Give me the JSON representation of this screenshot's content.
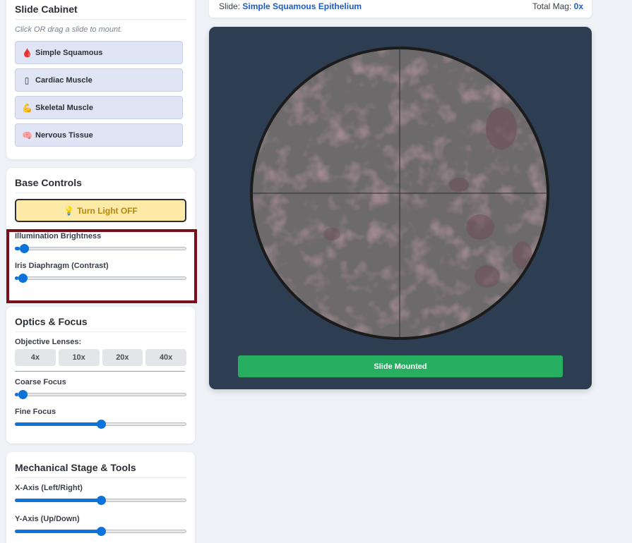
{
  "cabinet": {
    "title": "Slide Cabinet",
    "hint": "Click OR drag a slide to mount.",
    "slides": [
      {
        "icon": "🩸",
        "label": "Simple Squamous"
      },
      {
        "icon": "▯",
        "label": "Cardiac Muscle"
      },
      {
        "icon": "💪",
        "label": "Skeletal Muscle"
      },
      {
        "icon": "🧠",
        "label": "Nervous Tissue"
      }
    ]
  },
  "base": {
    "title": "Base Controls",
    "light_icon": "💡",
    "light_label": "Turn Light OFF",
    "brightness_label": "Illumination Brightness",
    "brightness_value": 0.03,
    "iris_label": "Iris Diaphragm (Contrast)",
    "iris_value": 0.02
  },
  "optics": {
    "title": "Optics & Focus",
    "lens_label": "Objective Lenses:",
    "lenses": [
      "4x",
      "10x",
      "20x",
      "40x"
    ],
    "coarse_label": "Coarse Focus",
    "coarse_value": 0.02,
    "fine_label": "Fine Focus",
    "fine_value": 0.5
  },
  "mech": {
    "title": "Mechanical Stage & Tools",
    "x_label": "X-Axis (Left/Right)",
    "x_value": 0.5,
    "y_label": "Y-Axis (Up/Down)",
    "y_value": 0.5
  },
  "status": {
    "slide_prefix": "Slide:",
    "slide_name": "Simple Squamous Epithelium",
    "mag_prefix": "Total Mag:",
    "mag_value": "0x"
  },
  "viewer": {
    "mount_label": "Slide Mounted"
  },
  "colors": {
    "accent": "#0b73d9",
    "mounted": "#27ae60",
    "highlight": "#7a0f1c",
    "scope_bg": "#2e3e52"
  }
}
